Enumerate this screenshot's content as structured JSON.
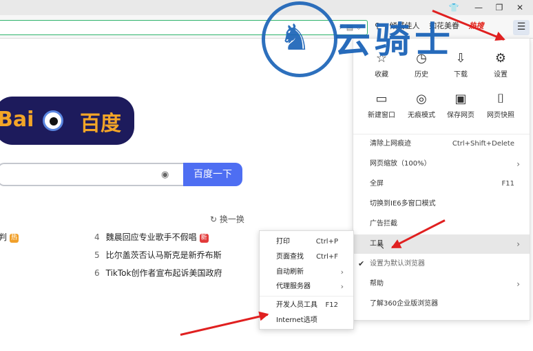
{
  "window_controls": {
    "skin": "👕",
    "minimize": "—",
    "restore": "❐",
    "close": "✕"
  },
  "toolbar": {
    "search_hints": [
      "倾城佳人",
      "如花美眷"
    ],
    "hot_label": "热搜",
    "menu_icon": "☰"
  },
  "search": {
    "button_label": "百度一下",
    "camera_icon": "camera-icon"
  },
  "logo": {
    "text_left": "Bai",
    "text_right": "百度"
  },
  "hot_list": {
    "refresh_label": "换一换",
    "items": [
      {
        "num": "",
        "title": "判",
        "tag": "热",
        "tag_color": "#f1a02a"
      },
      {
        "num": "4",
        "title": "魏晨回应专业歌手不假唱",
        "tag": "新",
        "tag_color": "#e23a3a"
      },
      {
        "num": "5",
        "title": "比尔盖茨否认马斯克是新乔布斯",
        "tag": "",
        "tag_color": ""
      },
      {
        "num": "6",
        "title": "TikTok创作者宣布起诉美国政府",
        "tag": "",
        "tag_color": ""
      }
    ]
  },
  "main_menu": {
    "icon_row1": [
      {
        "label": "收藏",
        "icon": "☆",
        "icon_name": "star-icon"
      },
      {
        "label": "历史",
        "icon": "◷",
        "icon_name": "clock-icon"
      },
      {
        "label": "下载",
        "icon": "⇩",
        "icon_name": "download-icon"
      },
      {
        "label": "设置",
        "icon": "⚙",
        "icon_name": "gear-icon"
      }
    ],
    "icon_row2": [
      {
        "label": "新建窗口",
        "icon": "▭",
        "icon_name": "window-icon"
      },
      {
        "label": "无痕模式",
        "icon": "◎",
        "icon_name": "incognito-icon"
      },
      {
        "label": "保存网页",
        "icon": "▣",
        "icon_name": "save-icon"
      },
      {
        "label": "网页快照",
        "icon": "⌷",
        "icon_name": "camera-icon"
      }
    ],
    "items": [
      {
        "label": "清除上网痕迹",
        "shortcut": "Ctrl+Shift+Delete",
        "arrow": false
      },
      {
        "label": "网页缩放（100%）",
        "shortcut": "",
        "arrow": true
      },
      {
        "label": "全屏",
        "shortcut": "F11",
        "arrow": false
      },
      {
        "label": "切换到IE6多窗口模式",
        "shortcut": "",
        "arrow": false
      },
      {
        "label": "广告拦截",
        "shortcut": "",
        "arrow": false
      },
      {
        "label": "工具",
        "shortcut": "",
        "arrow": true
      },
      {
        "label": "设置为默认浏览器",
        "shortcut": "",
        "arrow": false
      },
      {
        "label": "帮助",
        "shortcut": "",
        "arrow": true
      },
      {
        "label": "了解360企业版浏览器",
        "shortcut": "",
        "arrow": false
      }
    ]
  },
  "tools_submenu": {
    "items": [
      {
        "label": "打印",
        "shortcut": "Ctrl+P",
        "arrow": false
      },
      {
        "label": "页面查找",
        "shortcut": "Ctrl+F",
        "arrow": false
      },
      {
        "label": "自动刷新",
        "shortcut": "",
        "arrow": true
      },
      {
        "label": "代理服务器",
        "shortcut": "",
        "arrow": true
      },
      {
        "label": "开发人员工具",
        "shortcut": "F12",
        "arrow": false
      },
      {
        "label": "Internet选项",
        "shortcut": "",
        "arrow": false
      }
    ]
  },
  "watermark": {
    "text": "云骑士",
    "emblem": "♞"
  },
  "colors": {
    "accent": "#4e6ef2",
    "arrow": "#e02020",
    "watermark": "#1c64b8"
  }
}
